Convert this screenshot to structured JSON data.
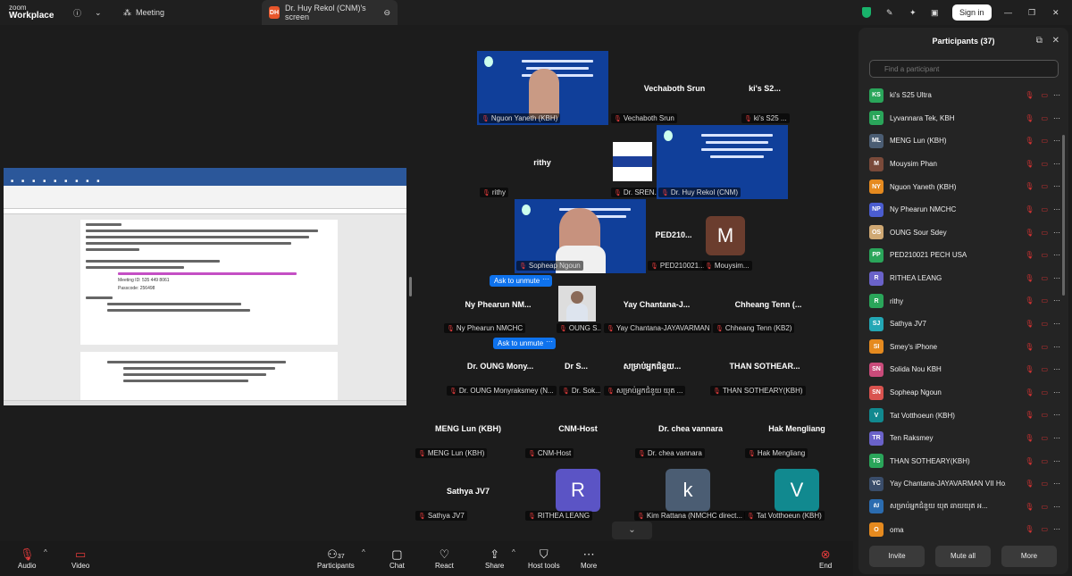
{
  "app": {
    "brand_top": "zoom",
    "brand_bottom": "Workplace"
  },
  "topbar": {
    "meeting_tab": "Meeting",
    "screen_tab_initials": "DH",
    "screen_tab": "Dr. Huy Rekol (CNM)'s screen",
    "sign_in": "Sign in"
  },
  "gallery": {
    "tiles": [
      {
        "type": "video",
        "label": "Nguon Yaneth (KBH)"
      },
      {
        "type": "name",
        "name": "Vechaboth Srun",
        "label": "Vechaboth Srun"
      },
      {
        "type": "name",
        "name": "ki's S2...",
        "label": "ki's S25 ..."
      },
      {
        "type": "name",
        "name": "rithy",
        "label": "rithy"
      },
      {
        "type": "video",
        "label": "Dr. SREN..."
      },
      {
        "type": "video",
        "label": "Dr. Huy Rekol (CNM)"
      },
      {
        "type": "video",
        "label": "Sopheap Ngoun"
      },
      {
        "type": "name",
        "name": "PED210...",
        "label": "PED210021..."
      },
      {
        "type": "avatar",
        "letter": "M",
        "label": "Mouysim..."
      },
      {
        "type": "name",
        "name": "Ny Phearun NM...",
        "label": "Ny Phearun NMCHC"
      },
      {
        "type": "video",
        "label": "OUNG S..."
      },
      {
        "type": "name",
        "name": "Yay Chantana-J...",
        "label": "Yay Chantana-JAYAVARMAN ..."
      },
      {
        "type": "name",
        "name": "Chheang Tenn (...",
        "label": "Chheang Tenn (KB2)"
      },
      {
        "type": "name",
        "name": "Dr. OUNG Mony...",
        "label": "Dr. OUNG Monyraksmey (N..."
      },
      {
        "type": "name",
        "name": "Dr S...",
        "label": "Dr. Sok..."
      },
      {
        "type": "name",
        "name": "សម្រាប់អ្នកជំនួយ...",
        "label": "សម្រាប់អ្នកជំនួយ យុត ... "
      },
      {
        "type": "name",
        "name": "THAN SOTHEAR...",
        "label": "THAN SOTHEARY(KBH)"
      },
      {
        "type": "name",
        "name": "MENG Lun (KBH)",
        "label": "MENG Lun (KBH)"
      },
      {
        "type": "name",
        "name": "CNM-Host",
        "label": "CNM-Host"
      },
      {
        "type": "name",
        "name": "Dr. chea vannara",
        "label": "Dr. chea vannara"
      },
      {
        "type": "name",
        "name": "Hak Mengliang",
        "label": "Hak Mengliang"
      },
      {
        "type": "name",
        "name": "Sathya JV7",
        "label": "Sathya JV7"
      },
      {
        "type": "avatar",
        "letter": "R",
        "label": "RITHEA LEANG"
      },
      {
        "type": "avatar",
        "letter": "k",
        "label": "Kim Rattana (NMCHC direct..."
      },
      {
        "type": "avatar",
        "letter": "V",
        "label": "Tat Votthoeun (KBH)"
      }
    ],
    "ask_to_unmute": "Ask to unmute",
    "more": "···"
  },
  "shared_doc": {
    "meeting_id": "Meeting ID:  535 449 8061",
    "passcode": "Passcode: 256498"
  },
  "participants": {
    "title": "Participants (37)",
    "search_placeholder": "Find a participant",
    "list": [
      {
        "initials": "KS",
        "name": "ki's S25 Ultra",
        "color": "#2aa55a"
      },
      {
        "initials": "LT",
        "name": "Lyvannara Tek, KBH",
        "color": "#2aa55a"
      },
      {
        "initials": "ML",
        "name": "MENG Lun (KBH)",
        "color": "#4b5d73"
      },
      {
        "initials": "M",
        "name": "Mouysim Phan",
        "color": "#7a4a3a"
      },
      {
        "initials": "NY",
        "name": "Nguon Yaneth (KBH)",
        "color": "#e58a1f"
      },
      {
        "initials": "NP",
        "name": "Ny Phearun NMCHC",
        "color": "#4b5dd0"
      },
      {
        "initials": "OS",
        "name": "OUNG Sour Sdey",
        "color": "#cfa873"
      },
      {
        "initials": "PP",
        "name": "PED210021 PECH USA",
        "color": "#2aa55a"
      },
      {
        "initials": "R",
        "name": "RITHEA LEANG",
        "color": "#6a62c9"
      },
      {
        "initials": "R",
        "name": "rithy",
        "color": "#2aa55a"
      },
      {
        "initials": "SJ",
        "name": "Sathya JV7",
        "color": "#23a7b5"
      },
      {
        "initials": "SI",
        "name": "Smey's iPhone",
        "color": "#e58a1f"
      },
      {
        "initials": "SN",
        "name": "Solida Nou KBH",
        "color": "#c94b7a"
      },
      {
        "initials": "SN",
        "name": "Sopheap Ngoun",
        "color": "#d9534f"
      },
      {
        "initials": "V",
        "name": "Tat Votthoeun (KBH)",
        "color": "#11898f"
      },
      {
        "initials": "TR",
        "name": "Ten Raksmey",
        "color": "#6a62c9"
      },
      {
        "initials": "TS",
        "name": "THAN SOTHEARY(KBH)",
        "color": "#2aa55a"
      },
      {
        "initials": "YC",
        "name": "Yay Chantana-JAYAVARMAN VII Ho...",
        "color": "#3a4d6a"
      },
      {
        "initials": "ស",
        "name": "សម្រាប់អ្នកជំនួយ យុត ឆាយយុត អ...",
        "color": "#2b6cb0"
      },
      {
        "initials": "O",
        "name": "oma",
        "color": "#e58a1f"
      }
    ],
    "invite": "Invite",
    "mute_all": "Mute all",
    "more_btn": "More"
  },
  "bottombar": {
    "audio": "Audio",
    "video": "Video",
    "participants": "Participants",
    "participants_count": "37",
    "chat": "Chat",
    "react": "React",
    "share": "Share",
    "host_tools": "Host tools",
    "more": "More",
    "end": "End"
  }
}
